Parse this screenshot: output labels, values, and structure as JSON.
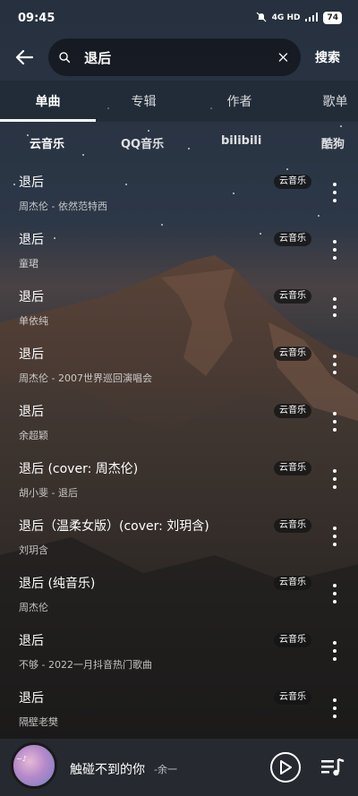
{
  "status": {
    "time": "09:45",
    "network": "4G HD",
    "battery": "74"
  },
  "search": {
    "query": "退后",
    "button": "搜索"
  },
  "tabs": [
    {
      "label": "单曲"
    },
    {
      "label": "专辑"
    },
    {
      "label": "作者"
    },
    {
      "label": "歌单"
    }
  ],
  "sources": [
    {
      "label": "云音乐"
    },
    {
      "label": "QQ音乐"
    },
    {
      "label": "bilibili"
    },
    {
      "label": "酷狗"
    }
  ],
  "songs": [
    {
      "title": "退后",
      "subtitle": "周杰伦 - 依然范特西",
      "badge": "云音乐"
    },
    {
      "title": "退后",
      "subtitle": "童珺",
      "badge": "云音乐"
    },
    {
      "title": "退后",
      "subtitle": "单依纯",
      "badge": "云音乐"
    },
    {
      "title": "退后",
      "subtitle": "周杰伦 - 2007世界巡回演唱会",
      "badge": "云音乐"
    },
    {
      "title": "退后",
      "subtitle": "余超颖",
      "badge": "云音乐"
    },
    {
      "title": "退后 (cover: 周杰伦)",
      "subtitle": "胡小斐 - 退后",
      "badge": "云音乐"
    },
    {
      "title": "退后（温柔女版）(cover: 刘玥含)",
      "subtitle": "刘玥含",
      "badge": "云音乐"
    },
    {
      "title": "退后 (纯音乐)",
      "subtitle": "周杰伦",
      "badge": "云音乐"
    },
    {
      "title": "退后",
      "subtitle": "不够 - 2022一月抖音热门歌曲",
      "badge": "云音乐"
    },
    {
      "title": "退后",
      "subtitle": "隔壁老樊",
      "badge": "云音乐"
    }
  ],
  "player": {
    "title": "触碰不到的你",
    "artist": "-余一"
  }
}
